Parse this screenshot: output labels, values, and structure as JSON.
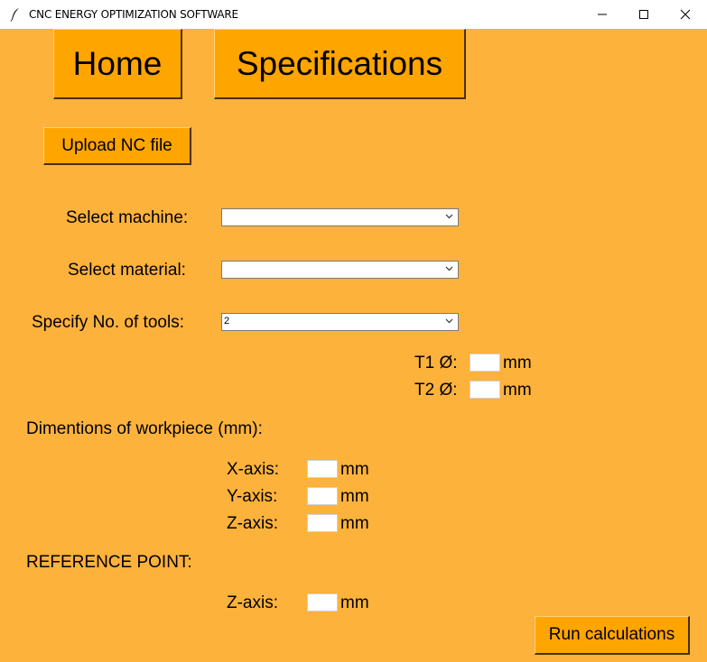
{
  "window": {
    "title": "CNC ENERGY OPTIMIZATION SOFTWARE",
    "app_icon": "feather-icon",
    "controls": [
      "minimize-icon",
      "maximize-icon",
      "close-icon"
    ]
  },
  "colors": {
    "background": "#fdb23c",
    "button": "#ffa500"
  },
  "nav": {
    "home_label": "Home",
    "specifications_label": "Specifications"
  },
  "upload": {
    "label": "Upload NC file"
  },
  "form": {
    "machine_label": "Select machine:",
    "machine_value": "",
    "material_label": "Select material:",
    "material_value": "",
    "tools_label": "Specify No. of tools:",
    "tools_value": "2",
    "t1_label": "T1 Ø:",
    "t1_value": "",
    "t1_unit": "mm",
    "t2_label": "T2 Ø:",
    "t2_value": "",
    "t2_unit": "mm"
  },
  "workpiece": {
    "heading": "Dimentions of workpiece (mm):",
    "x_label": "X-axis:",
    "x_value": "",
    "x_unit": "mm",
    "y_label": "Y-axis:",
    "y_value": "",
    "y_unit": "mm",
    "z_label": "Z-axis:",
    "z_value": "",
    "z_unit": "mm"
  },
  "reference": {
    "heading": "REFERENCE POINT:",
    "z_label": "Z-axis:",
    "z_value": "",
    "z_unit": "mm"
  },
  "run": {
    "label": "Run calculations"
  }
}
